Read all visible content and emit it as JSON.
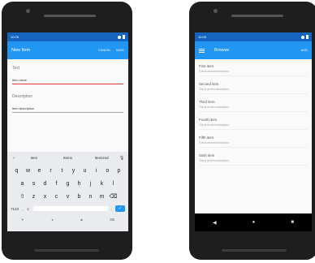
{
  "left": {
    "status": {
      "time": "10:05"
    },
    "toolbar": {
      "title": "New Item",
      "cancel": "CANCEL",
      "save": "SAVE"
    },
    "form": {
      "text_label": "Text",
      "text_value": "Item name",
      "description_label": "Description",
      "description_value": "Item description"
    },
    "keyboard": {
      "suggestions": [
        "Item",
        "Items",
        "Itemized"
      ],
      "row1": [
        "q",
        "w",
        "e",
        "r",
        "t",
        "y",
        "u",
        "i",
        "o",
        "p"
      ],
      "row2": [
        "a",
        "s",
        "d",
        "f",
        "g",
        "h",
        "j",
        "k",
        "l"
      ],
      "row3": [
        "z",
        "x",
        "c",
        "v",
        "b",
        "n",
        "m"
      ],
      "numbers_key": "?123",
      "comma_key": ",",
      "period_key": "."
    }
  },
  "right": {
    "status": {
      "time": "10:05"
    },
    "toolbar": {
      "title": "Browse",
      "add": "ADD"
    },
    "items": [
      {
        "title": "First item",
        "description": "This is an item description."
      },
      {
        "title": "Second item",
        "description": "This is an item description."
      },
      {
        "title": "Third item",
        "description": "This is an item description."
      },
      {
        "title": "Fourth item",
        "description": "This is an item description."
      },
      {
        "title": "Fifth item",
        "description": "This is an item description."
      },
      {
        "title": "Sixth item",
        "description": "This is an item description."
      }
    ]
  },
  "colors": {
    "primary": "#2196f3",
    "primary_dark": "#1565c0",
    "accent": "#e53935"
  }
}
